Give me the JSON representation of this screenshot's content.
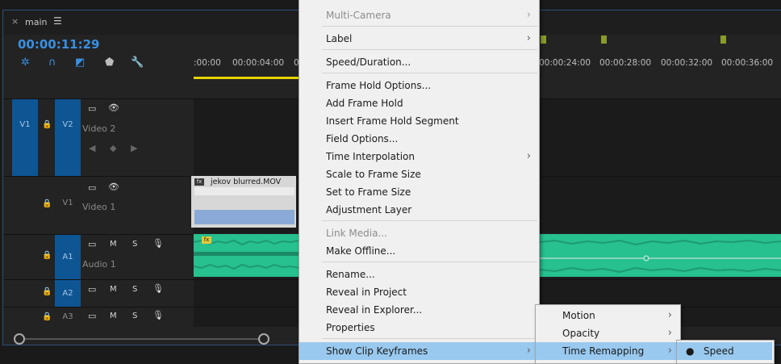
{
  "panel": {
    "tab_title": "main",
    "timecode": "00:00:11:29",
    "ruler_ticks": [
      ":00:00",
      "00:00:04:00",
      "0",
      "00:00:24:00",
      "00:00:28:00",
      "00:00:32:00",
      "00:00:36:00"
    ]
  },
  "tracks": {
    "v2": {
      "source": "V1",
      "target": "V2",
      "name": "Video 2"
    },
    "v1": {
      "target": "V1",
      "name": "Video 1"
    },
    "a1": {
      "target": "A1",
      "name": "Audio 1",
      "m": "M",
      "s": "S"
    },
    "a2": {
      "target": "A2",
      "m": "M",
      "s": "S"
    },
    "a3": {
      "target": "A3",
      "m": "M",
      "s": "S"
    }
  },
  "clip": {
    "name": "jekov blurred.MOV",
    "fx": "fx"
  },
  "context_menu": {
    "items": [
      {
        "label": "Multi-Camera",
        "disabled": true,
        "submenu": true
      },
      {
        "label": "Label",
        "submenu": true
      },
      {
        "label": "Speed/Duration..."
      },
      {
        "label": "Frame Hold Options..."
      },
      {
        "label": "Add Frame Hold"
      },
      {
        "label": "Insert Frame Hold Segment"
      },
      {
        "label": "Field Options..."
      },
      {
        "label": "Time Interpolation",
        "submenu": true
      },
      {
        "label": "Scale to Frame Size"
      },
      {
        "label": "Set to Frame Size"
      },
      {
        "label": "Adjustment Layer"
      },
      {
        "label": "Link Media...",
        "disabled": true
      },
      {
        "label": "Make Offline..."
      },
      {
        "label": "Rename..."
      },
      {
        "label": "Reveal in Project"
      },
      {
        "label": "Reveal in Explorer..."
      },
      {
        "label": "Properties"
      },
      {
        "label": "Show Clip Keyframes",
        "submenu": true,
        "highlighted": true
      }
    ]
  },
  "submenu_keyframes": {
    "items": [
      {
        "label": "Motion",
        "submenu": true
      },
      {
        "label": "Opacity",
        "submenu": true
      },
      {
        "label": "Time Remapping",
        "submenu": true,
        "highlighted": true
      }
    ]
  },
  "submenu_time_remapping": {
    "items": [
      {
        "label": "Speed",
        "checked": true,
        "highlighted": true
      }
    ]
  }
}
